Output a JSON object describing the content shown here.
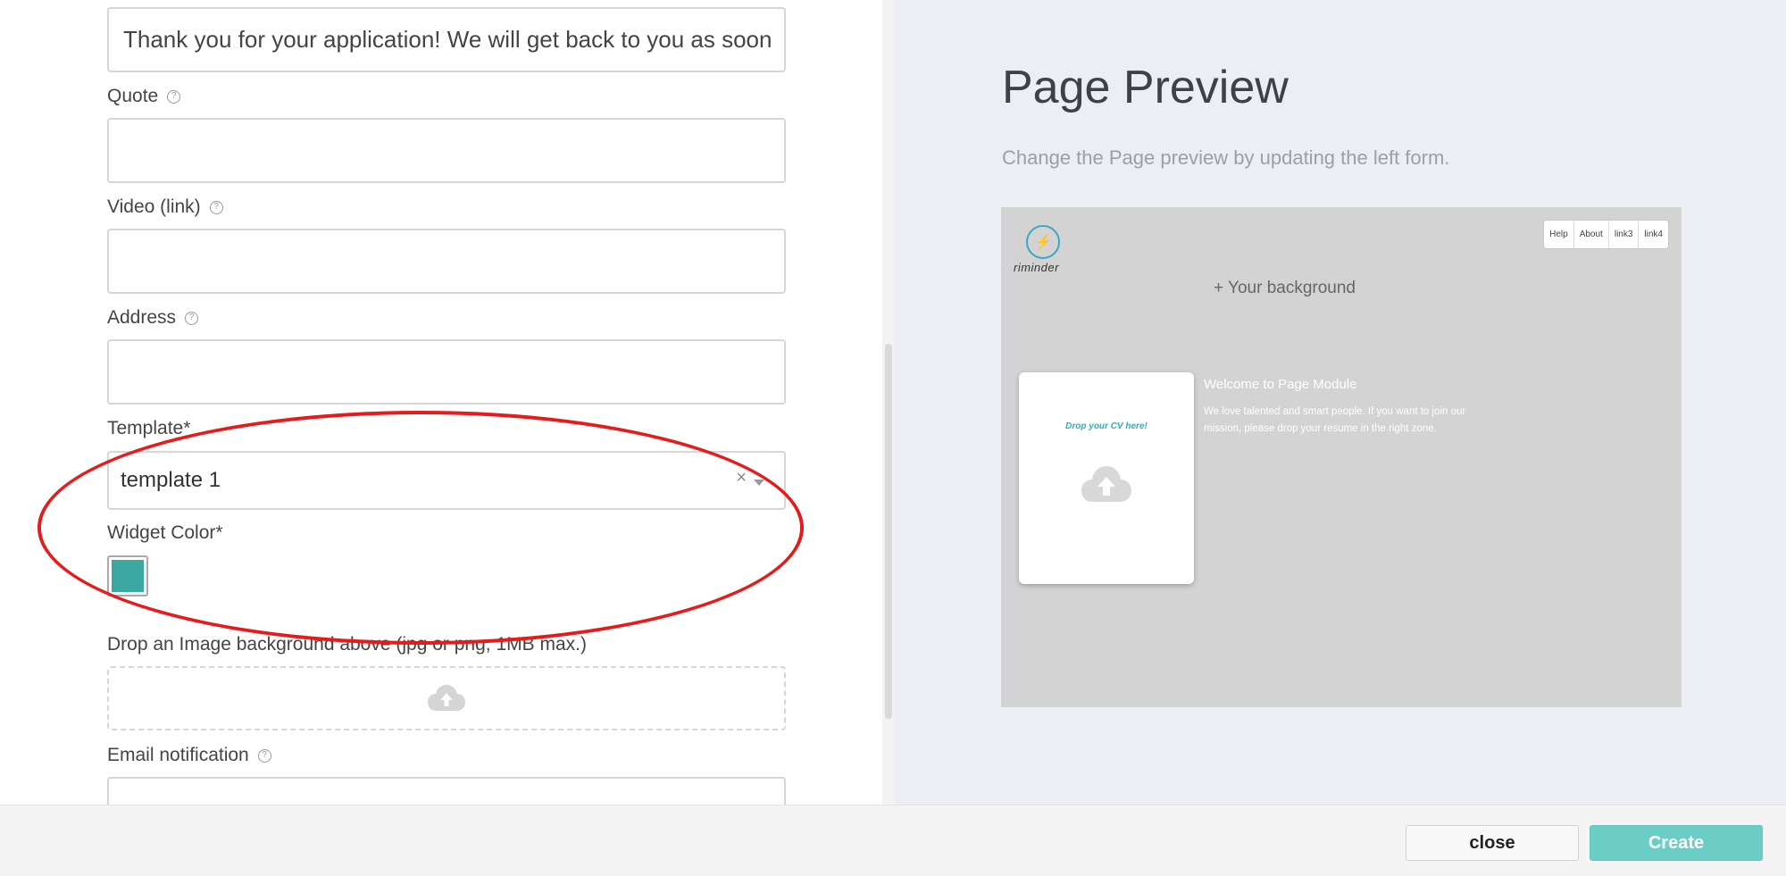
{
  "form": {
    "thank_you_message_value": "Thank you for your application! We will get back to you as soon",
    "quote": {
      "label": "Quote",
      "help": "?",
      "value": ""
    },
    "video": {
      "label": "Video (link)",
      "help": "?",
      "value": ""
    },
    "address": {
      "label": "Address",
      "help": "?",
      "value": ""
    },
    "template": {
      "label": "Template*",
      "value": "template 1",
      "clear": "×"
    },
    "widget_color": {
      "label": "Widget Color*",
      "color": "#3aa8a1"
    },
    "image_background": {
      "label": "Drop an Image background above (jpg or png, 1MB max.)"
    },
    "email_notification": {
      "label": "Email notification",
      "help": "?"
    }
  },
  "preview": {
    "title": "Page Preview",
    "subtitle": "Change the Page preview by updating the left form.",
    "logo_text": "riminder",
    "nav_links": [
      "Help",
      "About",
      "link3",
      "link4"
    ],
    "background_text": "+ Your background",
    "cv_card_title": "Drop your CV here!",
    "welcome_title": "Welcome to Page Module",
    "welcome_text": "We love talented and smart people. If you want to join our mission, please drop your resume in the right zone."
  },
  "footer": {
    "close_label": "close",
    "create_label": "Create"
  },
  "colors": {
    "accent": "#6ccdc7",
    "annotation": "#e41c1c",
    "widget": "#3aa8a1"
  }
}
